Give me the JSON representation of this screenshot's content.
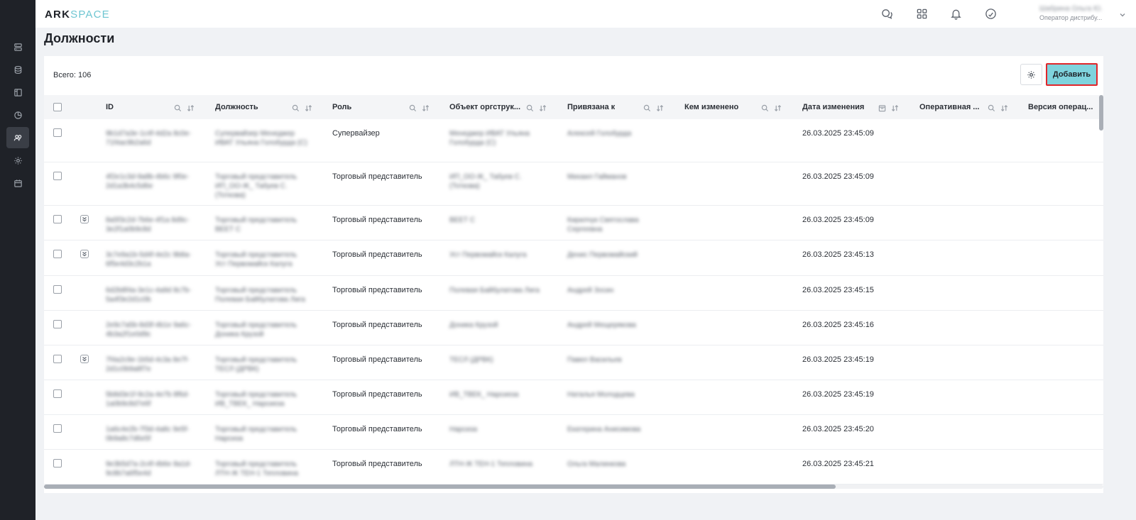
{
  "app": {
    "logo_part1": "ARK",
    "logo_part2": "SPACE"
  },
  "user": {
    "name": "Шабрина Ольга Ю.",
    "role": "Оператор дистрибу..."
  },
  "page": {
    "title": "Должности",
    "total": "Всего: 106",
    "add_label": "Добавить"
  },
  "sidebar": {
    "items": [
      "servers-icon",
      "database-icon",
      "layout-icon",
      "chart-pie-icon",
      "users-icon",
      "gear-icon",
      "calendar-icon"
    ],
    "active_index": 4
  },
  "header_icons": [
    "chat-icon",
    "apps-grid-icon",
    "bell-icon",
    "sync-icon"
  ],
  "table": {
    "columns": [
      "ID",
      "Должность",
      "Роль",
      "Объект оргструк...",
      "Привязана к",
      "Кем изменено",
      "Дата изменения",
      "Оперативная ...",
      "Версия операц..."
    ],
    "rows": [
      {
        "id": "9b1d7a3e-1c4f-4d2a 8c0e-71f4ac9b2a6d",
        "position": "Супервайзер Менеджер ИВАТ Ульяна Голобурда (С)",
        "role": "Супервайзер",
        "org": "Менеджер ИВАТ Ульяна Голобурда (С)",
        "bound": "Алексей Голобурда",
        "changed_by": "",
        "date": "26.03.2025 23:45:09",
        "expand": false
      },
      {
        "id": "4f2e1c3d-9a8b-4b6c 9f0e-2d1a3b4c5d6e",
        "position": "Торговый представитель ИП_ОО-Ж_ Табуев С. (Тоткова)",
        "role": "Торговый представитель",
        "org": "ИП_ОО-Ж_ Табуев С. (Тоткова)",
        "bound": "Михаил Гайманов",
        "changed_by": "",
        "date": "26.03.2025 23:45:09",
        "expand": false
      },
      {
        "id": "8a5f3c2d-7b6e-4f1a 8d9c-3e2f1a0b9c8d",
        "position": "Торговый представитель ВЕЕТ С",
        "role": "Торговый представитель",
        "org": "ВЕЕТ С",
        "bound": "Кирилчук Святослава Сергеевна",
        "changed_by": "",
        "date": "26.03.2025 23:45:09",
        "expand": true
      },
      {
        "id": "3c7e9a1b-5d4f-4e2c 9b8a-6f5e4d3c2b1a",
        "position": "Торговый представитель Уст Первомайск Калуга",
        "role": "Торговый представитель",
        "org": "Уст Первомайск Калуга",
        "bound": "Денис Первомайский",
        "changed_by": "",
        "date": "26.03.2025 23:45:13",
        "expand": true
      },
      {
        "id": "6d2b8f4a-3e1c-4a9d 8c7b-5a4f3e2d1c0b",
        "position": "Торговый представитель Полевая Байбулатова Лига",
        "role": "Торговый представитель",
        "org": "Полевая Байбулатова Лига",
        "bound": "Андрей Зосин",
        "changed_by": "",
        "date": "26.03.2025 23:45:15",
        "expand": false
      },
      {
        "id": "2e9c7a5b-8d3f-4b1e 9a6c-4b3a2f1e0d9c",
        "position": "Торговый представитель Доника Крузой",
        "role": "Торговый представитель",
        "org": "Доника Крузой",
        "bound": "Андрей Мещерякова",
        "changed_by": "",
        "date": "26.03.2025 23:45:16",
        "expand": false
      },
      {
        "id": "7f4a2c9e-1b5d-4c3a 8e7f-2d1c0b9a8f7e",
        "position": "Торговый представитель ТЕСЛ (ДРВК)",
        "role": "Торговый представитель",
        "org": "ТЕСЛ (ДРВК)",
        "bound": "Павел Васильев",
        "changed_by": "",
        "date": "26.03.2025 23:45:19",
        "expand": true
      },
      {
        "id": "5b8d3e1f-9c2a-4e7b 8f6d-1a0b9c8d7e6f",
        "position": "Торговый представитель ИВ_ТВЕК_ Нарсиеза",
        "role": "Торговый представитель",
        "org": "ИВ_ТВЕК_ Нарсиеза",
        "bound": "Наталья Молодцева",
        "changed_by": "",
        "date": "26.03.2025 23:45:19",
        "expand": false
      },
      {
        "id": "1a6c4e2b-7f3d-4a8c 9e5f-0b9a8c7d6e5f",
        "position": "Торговый представитель Нарсиза",
        "role": "Торговый представитель",
        "org": "Нарсиза",
        "bound": "Екатерина Анисимова",
        "changed_by": "",
        "date": "26.03.2025 23:45:20",
        "expand": false
      },
      {
        "id": "9e3b5d7a-2c4f-4b6e 8a1d-9c8b7a6f5e4d",
        "position": "Торговый представитель ЛТН-Ж ТЕН-1 Тепловина",
        "role": "Торговый представитель",
        "org": "ЛТН-Ж ТЕН-1 Тепловина",
        "bound": "Ольга Малинкова",
        "changed_by": "",
        "date": "26.03.2025 23:45:21",
        "expand": false
      }
    ]
  }
}
